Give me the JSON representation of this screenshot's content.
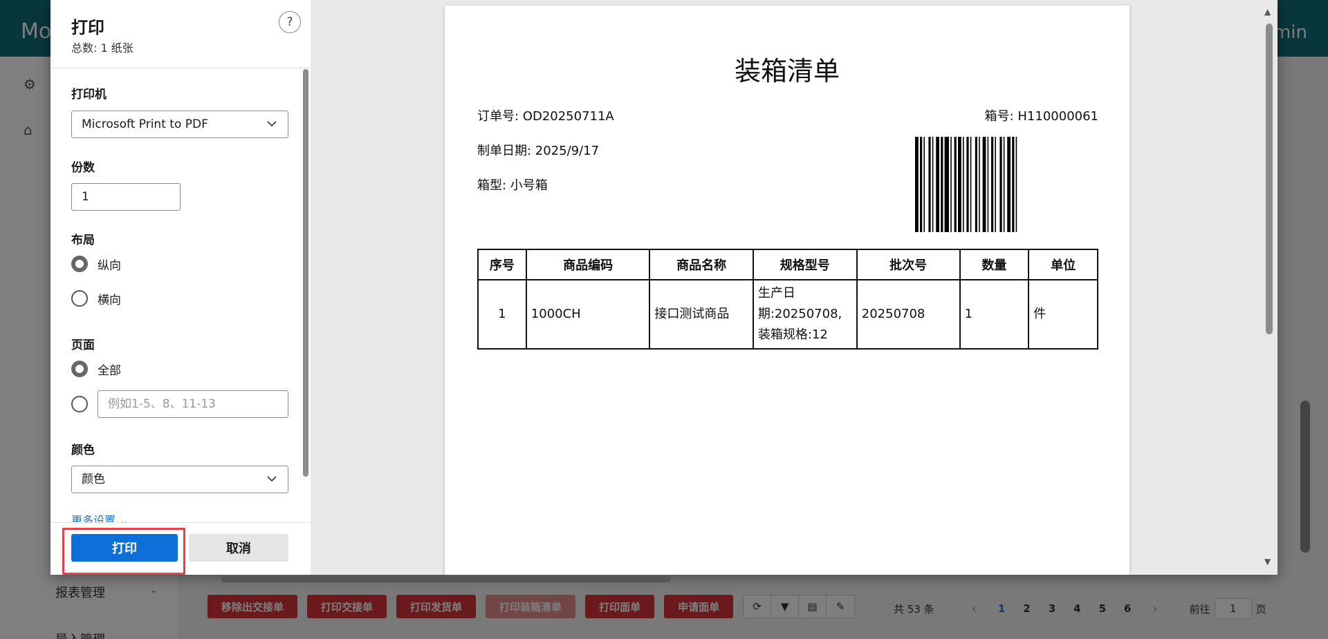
{
  "background": {
    "header_logo": "Mo",
    "header_user": "min",
    "sidebar": {
      "items": [
        {
          "label": "报表管理"
        },
        {
          "label": "导入管理"
        }
      ]
    },
    "toolbar_buttons": [
      {
        "label": "移除出交接单",
        "faded": false
      },
      {
        "label": "打印交接单",
        "faded": false
      },
      {
        "label": "打印发货单",
        "faded": false
      },
      {
        "label": "打印装箱清单",
        "faded": true
      },
      {
        "label": "打印面单",
        "faded": false
      },
      {
        "label": "申请面单",
        "faded": false
      }
    ],
    "pager": {
      "total": "共 53 条",
      "pages": [
        "1",
        "2",
        "3",
        "4",
        "5",
        "6"
      ],
      "active_page": "1",
      "goto_label": "前往",
      "goto_value": "1",
      "page_unit": "页"
    }
  },
  "dialog": {
    "title": "打印",
    "subtitle": "总数: 1 纸张",
    "help": "?",
    "printer": {
      "label": "打印机",
      "value": "Microsoft Print to PDF"
    },
    "copies": {
      "label": "份数",
      "value": "1"
    },
    "layout": {
      "label": "布局",
      "options": [
        {
          "label": "纵向",
          "checked": true
        },
        {
          "label": "横向",
          "checked": false
        }
      ]
    },
    "pages": {
      "label": "页面",
      "all_label": "全部",
      "custom_placeholder": "例如1-5、8、11-13"
    },
    "color": {
      "label": "颜色",
      "value": "颜色"
    },
    "more_settings": "更多设置",
    "print_button": "打印",
    "cancel_button": "取消",
    "highlight_color": "#e8404b",
    "accent_color": "#0d6fd8"
  },
  "document": {
    "title": "装箱清单",
    "order_no": "订单号: OD20250711A",
    "box_no": "箱号: H110000061",
    "created_date": "制单日期: 2025/9/17",
    "box_type": "箱型: 小号箱",
    "table": {
      "headers": [
        "序号",
        "商品编码",
        "商品名称",
        "规格型号",
        "批次号",
        "数量",
        "单位"
      ],
      "rows": [
        [
          "1",
          "1000CH",
          "接口测试商品",
          "生产日期:20250708,装箱规格:12",
          "20250708",
          "1",
          "件"
        ]
      ]
    }
  }
}
